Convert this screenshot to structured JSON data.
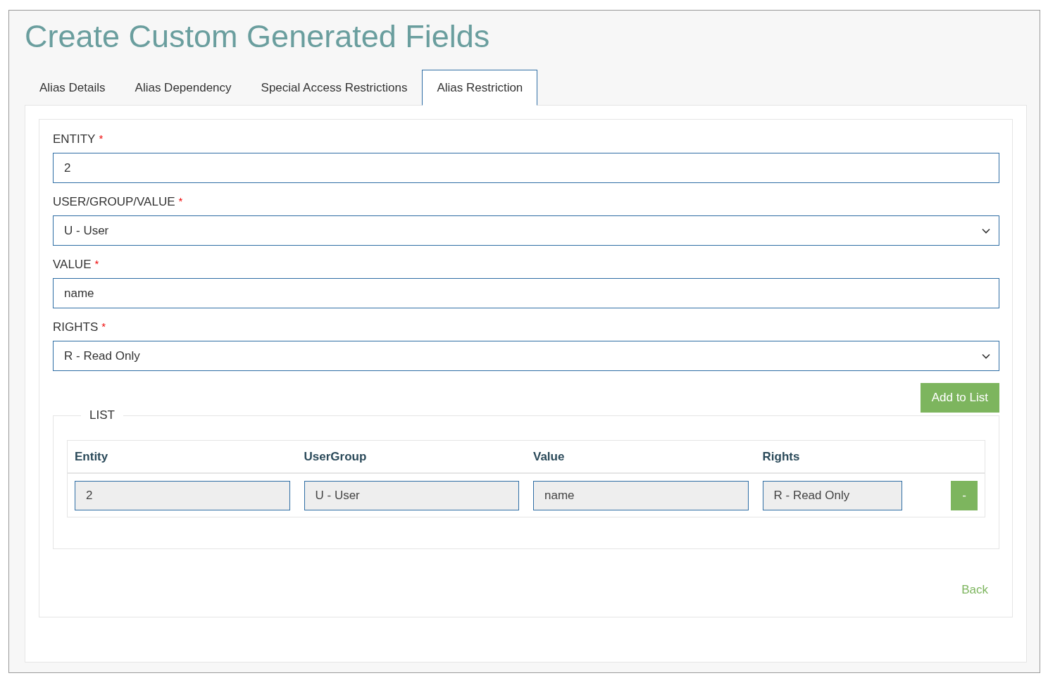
{
  "title": "Create Custom Generated Fields",
  "tabs": [
    {
      "label": "Alias Details",
      "selected": false
    },
    {
      "label": "Alias Dependency",
      "selected": false
    },
    {
      "label": "Special Access Restrictions",
      "selected": false
    },
    {
      "label": "Alias Restriction",
      "selected": true
    }
  ],
  "fields": [
    {
      "kind": "text",
      "label": "ENTITY",
      "required_mark": "*",
      "value": "2"
    },
    {
      "kind": "select",
      "label": "USER/GROUP/VALUE",
      "required_mark": "*",
      "value": "U - User"
    },
    {
      "kind": "text",
      "label": "VALUE",
      "required_mark": "*",
      "value": "name"
    },
    {
      "kind": "select",
      "label": "RIGHTS",
      "required_mark": "*",
      "value": "R - Read Only"
    }
  ],
  "add_button": "Add to List",
  "list": {
    "legend": "LIST",
    "columns": [
      "Entity",
      "UserGroup",
      "Value",
      "Rights"
    ],
    "rows": [
      {
        "cells": [
          "2",
          "U - User",
          "name",
          "R - Read Only"
        ],
        "remove_button": "-"
      }
    ]
  },
  "back_link": "Back"
}
